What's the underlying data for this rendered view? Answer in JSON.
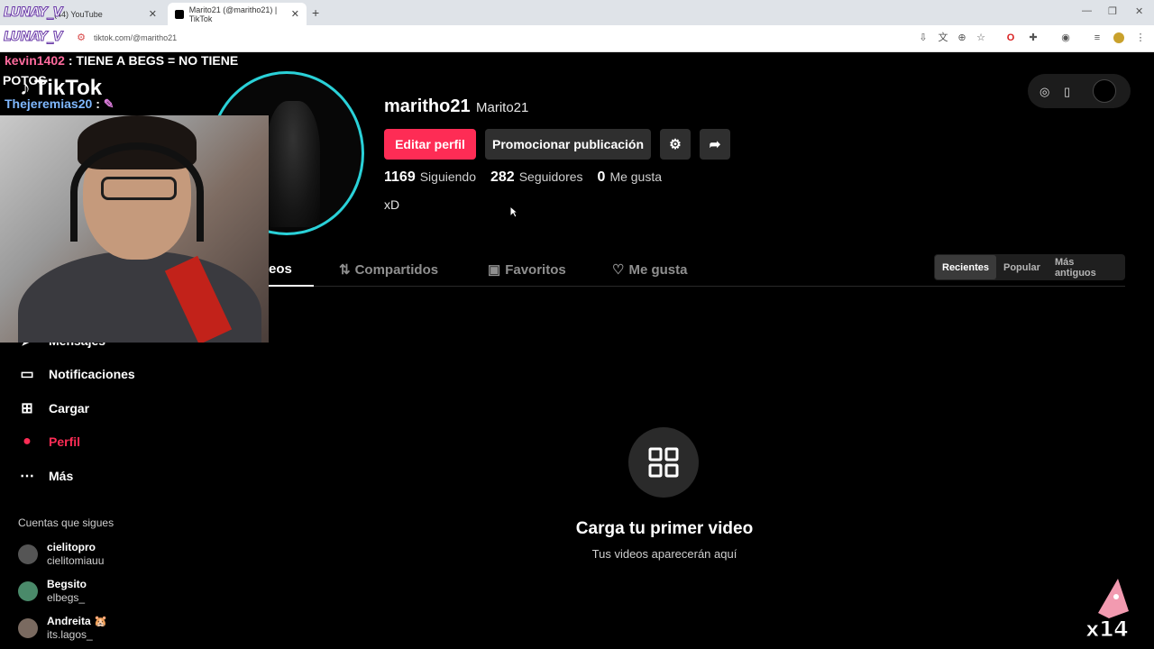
{
  "browser": {
    "tabs": [
      {
        "label": "(44) YouTube",
        "active": false
      },
      {
        "label": "Marito21 (@maritho21) | TikTok",
        "active": true
      }
    ],
    "url": "tiktok.com/@maritho21"
  },
  "overlay": {
    "logo_text": "LUNAY_V",
    "chat": [
      {
        "user": "kevin1402",
        "message": ": TIENE A BEGS = NO TIENE"
      },
      {
        "user": "",
        "message": "POTOS"
      },
      {
        "user": "Thejeremias20",
        "message": ":"
      }
    ],
    "sticker_text": "x14"
  },
  "brand": {
    "name": "TikTok"
  },
  "profile": {
    "username": "maritho21",
    "nickname": "Marito21",
    "edit_label": "Editar perfil",
    "promote_label": "Promocionar publicación",
    "stats": [
      {
        "value": "1169",
        "label": "Siguiendo"
      },
      {
        "value": "282",
        "label": "Seguidores"
      },
      {
        "value": "0",
        "label": "Me gusta"
      }
    ],
    "bio": "xD"
  },
  "tabs": [
    {
      "label": "Videos",
      "shown": "eos",
      "icon": "grid-icon",
      "active": true
    },
    {
      "label": "Compartidos",
      "icon": "repost-icon",
      "active": false
    },
    {
      "label": "Favoritos",
      "icon": "bookmark-icon",
      "active": false
    },
    {
      "label": "Me gusta",
      "icon": "heart-icon",
      "active": false
    }
  ],
  "sort": [
    "Recientes",
    "Popular",
    "Más antiguos"
  ],
  "sidebar": {
    "items": [
      {
        "label": "Mensajes",
        "icon": "send-icon"
      },
      {
        "label": "Notificaciones",
        "icon": "inbox-icon"
      },
      {
        "label": "Cargar",
        "icon": "upload-icon"
      },
      {
        "label": "Perfil",
        "icon": "avatar-icon",
        "active": true
      },
      {
        "label": "Más",
        "icon": "more-icon"
      }
    ],
    "following_title": "Cuentas que sigues",
    "following": [
      {
        "name": "cielitopro",
        "handle": "cielitomiauu"
      },
      {
        "name": "Begsito",
        "handle": "elbegs_"
      },
      {
        "name": "Andreita 🐹",
        "handle": "its.lagos_"
      }
    ]
  },
  "empty_state": {
    "title": "Carga tu primer video",
    "subtitle": "Tus videos aparecerán aquí"
  },
  "colors": {
    "accent": "#fe2c55",
    "ring": "#2ad1d8",
    "background": "#000000"
  }
}
